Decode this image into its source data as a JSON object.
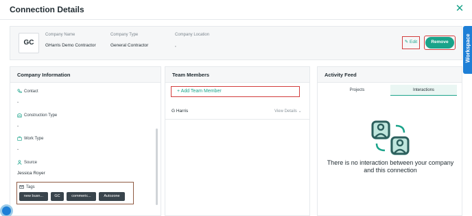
{
  "header": {
    "title": "Connection Details"
  },
  "company": {
    "logo_text": "GC",
    "fields": [
      {
        "label": "Company Name",
        "value": "GHarris Demo Contractor"
      },
      {
        "label": "Company Type",
        "value": "General Contractor"
      },
      {
        "label": "Company Location",
        "value": ","
      }
    ],
    "edit_label": "Edit",
    "remove_label": "Remove"
  },
  "workspace_tab": {
    "label": "Workspace"
  },
  "company_info": {
    "title": "Company Information",
    "items": [
      {
        "label": "Contact",
        "value": "-",
        "icon": "phone-icon"
      },
      {
        "label": "Construction Type",
        "value": "-",
        "icon": "building-icon"
      },
      {
        "label": "Work Type",
        "value": "-",
        "icon": "briefcase-icon"
      },
      {
        "label": "Source",
        "value": "Jessica Royer",
        "icon": "person-icon"
      }
    ],
    "tags_label": "Tags",
    "tags": [
      "new busn...",
      "GC",
      "commeric...",
      "Autozone"
    ]
  },
  "team": {
    "title": "Team Members",
    "add_label": "Add Team Member",
    "members": [
      {
        "name": "G Harris",
        "view_label": "View Details"
      }
    ]
  },
  "activity": {
    "title": "Activity Feed",
    "tabs": [
      {
        "label": "Projects",
        "active": false
      },
      {
        "label": "Interactions",
        "active": true
      }
    ],
    "empty_text": "There is no interaction between your company and this connection"
  },
  "colors": {
    "accent": "#1aa38a",
    "highlight_border": "#d23c3c",
    "workspace": "#1e7fd6"
  }
}
